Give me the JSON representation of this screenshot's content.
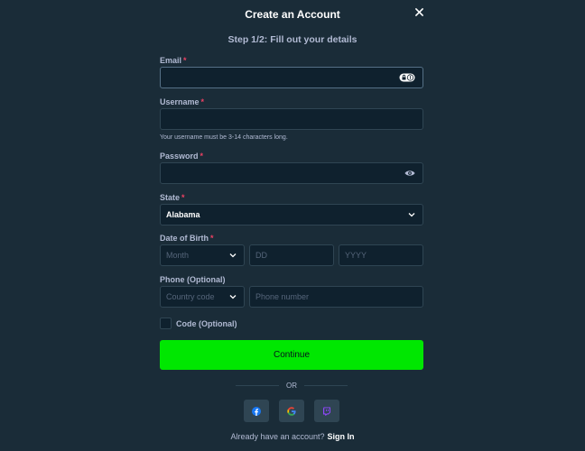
{
  "header": {
    "title": "Create an Account",
    "step": "Step 1/2: Fill out your details"
  },
  "form": {
    "email": {
      "label": "Email",
      "required": "*",
      "value": "",
      "placeholder": ""
    },
    "username": {
      "label": "Username",
      "required": "*",
      "value": "",
      "placeholder": "",
      "hint": "Your username must be 3-14 characters long."
    },
    "password": {
      "label": "Password",
      "required": "*",
      "value": "",
      "placeholder": ""
    },
    "state": {
      "label": "State",
      "required": "*",
      "selected": "Alabama"
    },
    "dob": {
      "label": "Date of Birth",
      "required": "*",
      "month_placeholder": "Month",
      "day_placeholder": "DD",
      "year_placeholder": "YYYY"
    },
    "phone": {
      "label": "Phone (Optional)",
      "country_placeholder": "Country code",
      "number_placeholder": "Phone number"
    },
    "code": {
      "label": "Code (Optional)",
      "checked": false
    }
  },
  "actions": {
    "continue_label": "Continue",
    "or_label": "OR"
  },
  "social": [
    "facebook-icon",
    "google-icon",
    "twitch-icon"
  ],
  "footer": {
    "prompt": "Already have an account?",
    "link": "Sign In"
  },
  "colors": {
    "background": "#1a2c38",
    "input_bg": "#0f212e",
    "input_border": "#2f4553",
    "accent_green": "#00e701",
    "required_red": "#ed4163",
    "text_muted": "#b1bad3"
  }
}
